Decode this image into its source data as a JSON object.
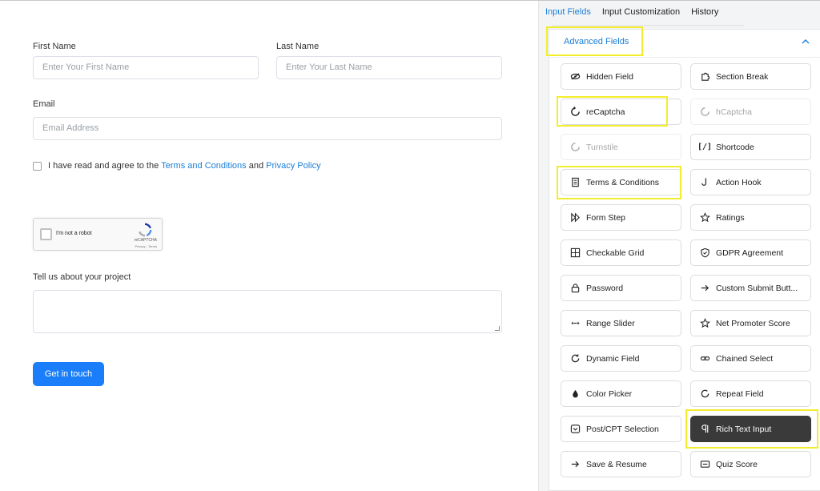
{
  "form": {
    "first_name": {
      "label": "First Name",
      "placeholder": "Enter Your First Name"
    },
    "last_name": {
      "label": "Last Name",
      "placeholder": "Enter Your Last Name"
    },
    "email": {
      "label": "Email",
      "placeholder": "Email Address"
    },
    "terms": {
      "prefix": "I have read and agree to the ",
      "terms_link": "Terms and Conditions",
      "middle": " and ",
      "privacy_link": "Privacy Policy"
    },
    "recaptcha": {
      "text": "I'm not a robot",
      "brand": "reCAPTCHA",
      "privacy": "Privacy - Terms"
    },
    "project": {
      "label": "Tell us about your project"
    },
    "submit_label": "Get in touch"
  },
  "sidebar": {
    "tabs": [
      "Input Fields",
      "Input Customization",
      "History"
    ],
    "section_title": "Advanced Fields",
    "fields": [
      {
        "label": "Hidden Field",
        "icon": "eye-slash-icon"
      },
      {
        "label": "Section Break",
        "icon": "puzzle-icon"
      },
      {
        "label": "reCaptcha",
        "icon": "recaptcha-icon"
      },
      {
        "label": "hCaptcha",
        "icon": "hcaptcha-icon"
      },
      {
        "label": "Turnstile",
        "icon": "turnstile-icon"
      },
      {
        "label": "Shortcode",
        "icon": "shortcode-icon"
      },
      {
        "label": "Terms & Conditions",
        "icon": "document-icon"
      },
      {
        "label": "Action Hook",
        "icon": "hook-icon"
      },
      {
        "label": "Form Step",
        "icon": "fast-forward-icon"
      },
      {
        "label": "Ratings",
        "icon": "star-icon"
      },
      {
        "label": "Checkable Grid",
        "icon": "grid-icon"
      },
      {
        "label": "GDPR Agreement",
        "icon": "shield-icon"
      },
      {
        "label": "Password",
        "icon": "lock-icon"
      },
      {
        "label": "Custom Submit Butt...",
        "icon": "arrow-right-icon"
      },
      {
        "label": "Range Slider",
        "icon": "range-slider-icon"
      },
      {
        "label": "Net Promoter Score",
        "icon": "star-outline-icon"
      },
      {
        "label": "Dynamic Field",
        "icon": "refresh-icon"
      },
      {
        "label": "Chained Select",
        "icon": "link-icon"
      },
      {
        "label": "Color Picker",
        "icon": "droplet-icon"
      },
      {
        "label": "Repeat Field",
        "icon": "repeat-icon"
      },
      {
        "label": "Post/CPT Selection",
        "icon": "post-icon"
      },
      {
        "label": "Rich Text Input",
        "icon": "paragraph-icon"
      },
      {
        "label": "Save & Resume",
        "icon": "save-arrow-icon"
      },
      {
        "label": "Quiz Score",
        "icon": "quiz-icon"
      }
    ]
  },
  "colors": {
    "accent": "#1a7efb",
    "link": "#1a7ed6",
    "highlight": "#f3ee2d",
    "dark_button": "#3a3a3a"
  }
}
